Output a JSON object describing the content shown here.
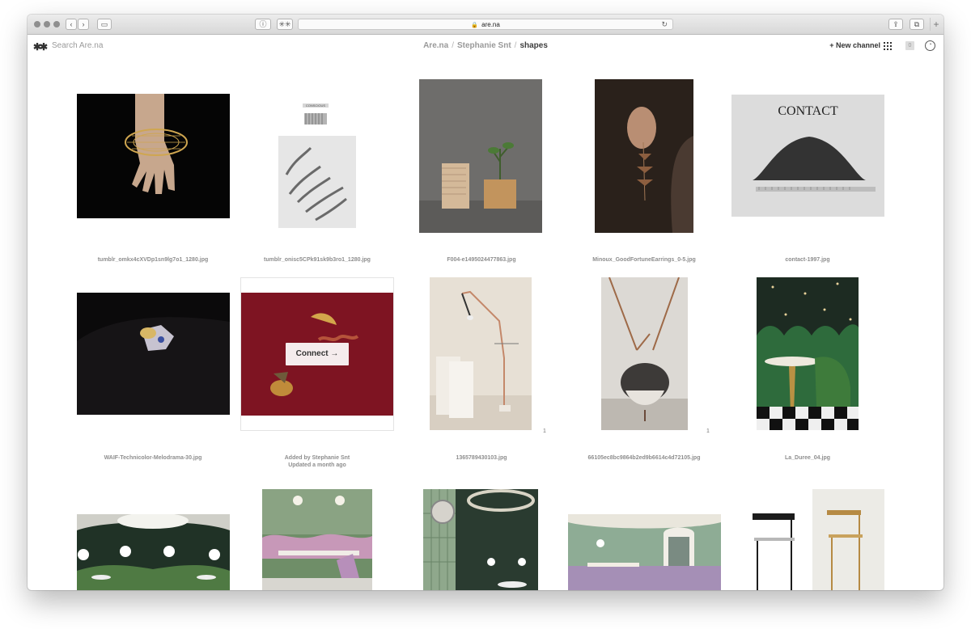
{
  "browser": {
    "url": "are.na"
  },
  "header": {
    "search_placeholder": "Search Are.na",
    "breadcrumb": [
      "Are.na",
      "Stephanie Snt",
      "shapes"
    ],
    "new_channel": "+ New channel",
    "notification_count": "0"
  },
  "blocks": [
    {
      "caption": "tumblr_omkx4cXVDp1sn9lg7o1_1280.jpg"
    },
    {
      "caption": "tumblr_onisc5CPk91sk9b3ro1_1280.jpg",
      "label": "CONSCIOUS"
    },
    {
      "caption": "F004-e1495024477863.jpg"
    },
    {
      "caption": "Minoux_GoodFortuneEarrings_0-5.jpg"
    },
    {
      "caption": "contact-1997.jpg",
      "text": "CONTACT"
    },
    {
      "caption": "WAIF-Technicolor-Melodrama-30.jpg"
    },
    {
      "hover_line1": "Added by Stephanie Snt",
      "hover_line2": "Updated a month ago",
      "connect": "Connect →"
    },
    {
      "caption": "1365789430103.jpg",
      "count": "1"
    },
    {
      "caption": "66105ec8bc9864b2ed9b6614c4d72105.jpg",
      "count": "1"
    },
    {
      "caption": "La_Duree_04.jpg"
    }
  ]
}
